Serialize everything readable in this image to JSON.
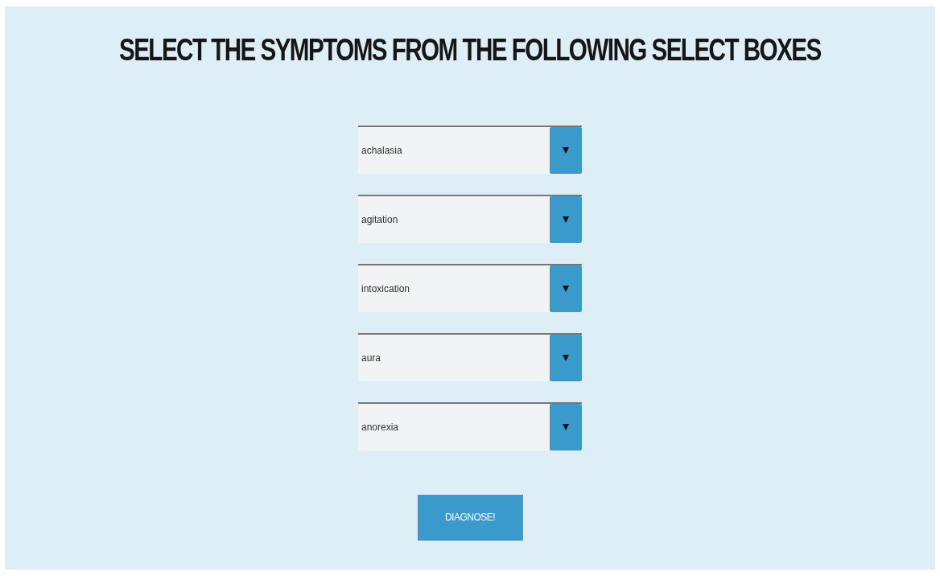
{
  "title": "SELECT THE SYMPTOMS FROM THE FOLLOWING SELECT BOXES",
  "selects": [
    {
      "value": "achalasia"
    },
    {
      "value": "agitation"
    },
    {
      "value": "intoxication"
    },
    {
      "value": "aura"
    },
    {
      "value": "anorexia"
    }
  ],
  "button": "DIAGNOSE!"
}
